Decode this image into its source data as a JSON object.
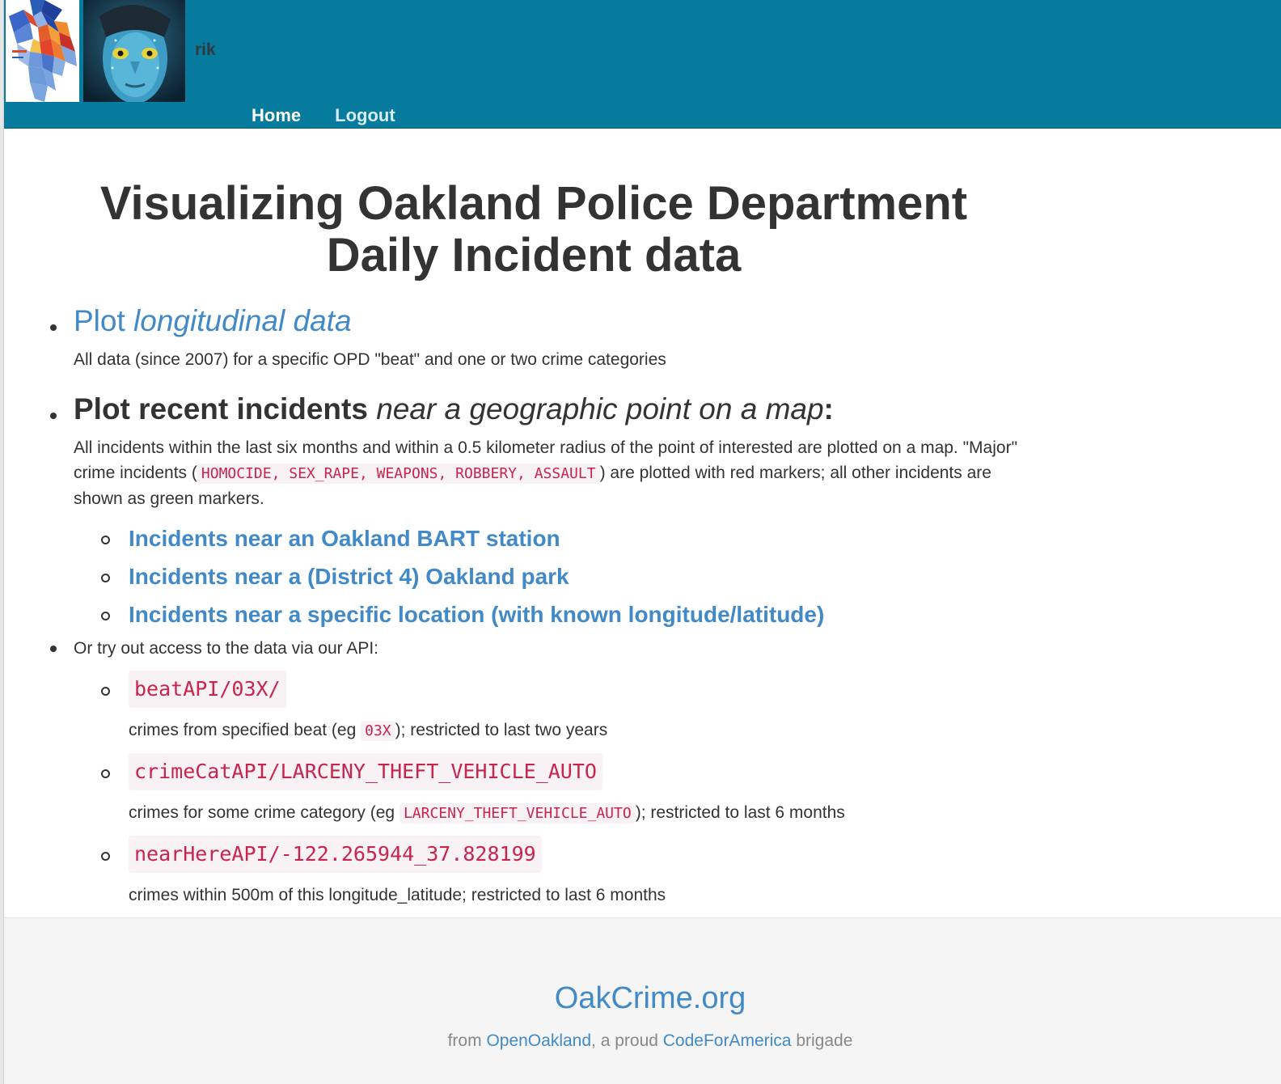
{
  "header": {
    "username": "rik",
    "nav": {
      "home": "Home",
      "logout": "Logout"
    },
    "colors": {
      "bar": "#067b9e"
    },
    "images": {
      "logo": "oakland-beat-map-logo",
      "avatar": "user-avatar-photo"
    }
  },
  "main": {
    "title_line1": "Visualizing Oakland Police Department",
    "title_line2": "Daily Incident data",
    "longitudinal": {
      "link_plain": "Plot ",
      "link_italic": "longitudinal data",
      "description": "All data (since 2007) for a specific OPD \"beat\" and one or two crime categories"
    },
    "recent": {
      "heading_plain": "Plot recent incidents ",
      "heading_italic": "near a geographic point on a map",
      "heading_colon": ":",
      "desc_part1": "All incidents within the last six months and within a 0.5 kilometer radius of the point of interested are plotted on a map. \"Major\" crime incidents (",
      "major_codes": "HOMOCIDE, SEX_RAPE, WEAPONS, ROBBERY, ASSAULT",
      "desc_part2": ") are plotted with red markers; all other incidents are shown as green markers.",
      "links": [
        "Incidents near an Oakland BART station",
        "Incidents near a (District 4) Oakland park",
        "Incidents near a specific location (with known longitude/latitude)"
      ]
    },
    "api": {
      "intro": "Or try out access to the data via our API:",
      "items": [
        {
          "endpoint": "beatAPI/03X/",
          "desc_before": "crimes from specified beat (eg ",
          "desc_code": "03X",
          "desc_after": "); restricted to last two years"
        },
        {
          "endpoint": "crimeCatAPI/LARCENY_THEFT_VEHICLE_AUTO",
          "desc_before": "crimes for some crime category (eg ",
          "desc_code": "LARCENY_THEFT_VEHICLE_AUTO",
          "desc_after": "); restricted to last 6 months"
        },
        {
          "endpoint": "nearHereAPI/-122.265944_37.828199",
          "desc_before": "crimes within 500m of this longitude_latitude; restricted to last 6 months",
          "desc_code": "",
          "desc_after": ""
        }
      ]
    }
  },
  "footer": {
    "brand": "OakCrime.org",
    "from": "from ",
    "org1": "OpenOakland",
    "middle": ", a proud ",
    "org2": "CodeForAmerica",
    "end": " brigade"
  }
}
